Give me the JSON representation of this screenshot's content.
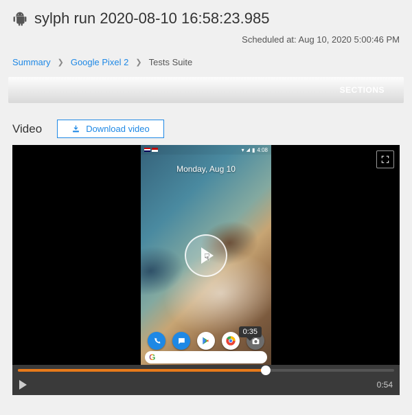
{
  "header": {
    "title": "sylph run 2020-08-10 16:58:23.985",
    "scheduled_label": "Scheduled at: Aug 10, 2020 5:00:46 PM"
  },
  "breadcrumb": {
    "summary": "Summary",
    "device": "Google Pixel 2",
    "current": "Tests Suite"
  },
  "sections_label": "SECTIONS",
  "video": {
    "heading": "Video",
    "download_label": "Download video"
  },
  "phone": {
    "date_text": "Monday, Aug 10",
    "status_time": "4:08",
    "google_g": "G"
  },
  "player": {
    "tooltip_time": "0:35",
    "duration": "0:54"
  }
}
